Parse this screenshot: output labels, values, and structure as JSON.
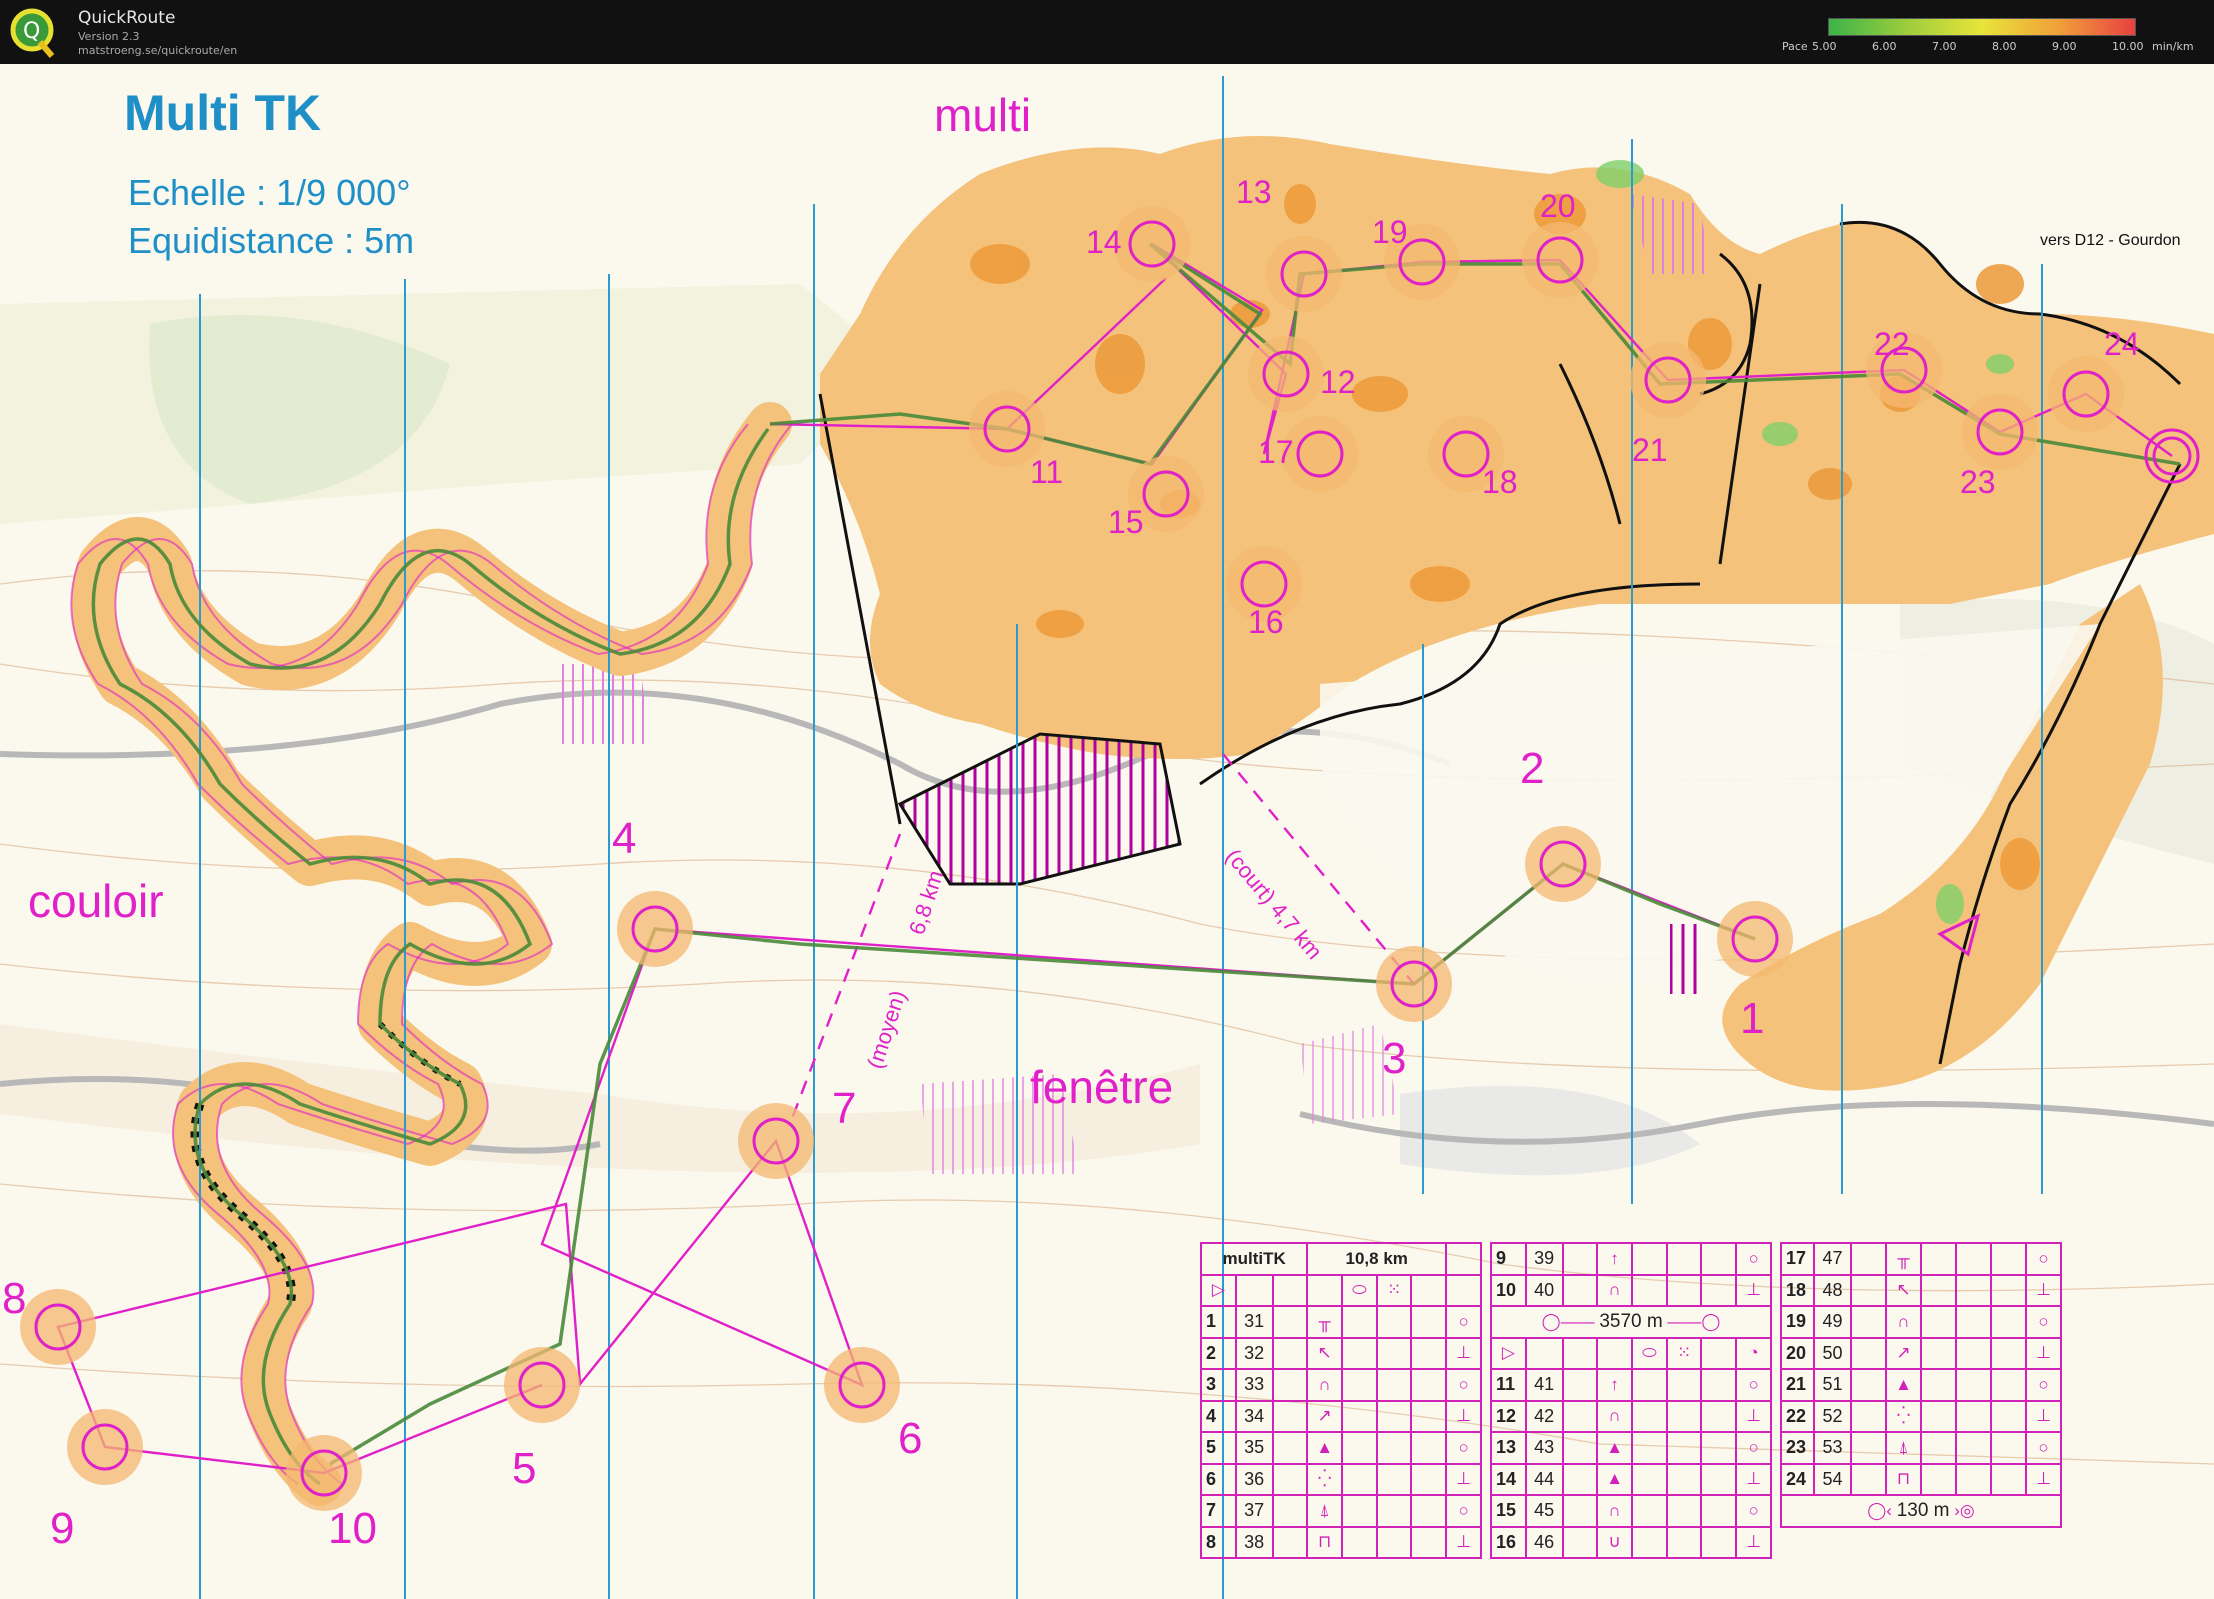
{
  "app": {
    "name": "QuickRoute",
    "version": "Version 2.3",
    "url": "matstroeng.se/quickroute/en"
  },
  "pace_scale": {
    "label": "Pace",
    "ticks": [
      "5.00",
      "6.00",
      "7.00",
      "8.00",
      "9.00",
      "10.00"
    ],
    "unit": "min/km",
    "colors": [
      "#3cb34a",
      "#9ccc3c",
      "#e8e43a",
      "#f0a03a",
      "#e84040"
    ]
  },
  "map": {
    "title": "Multi TK",
    "scale": "Echelle : 1/9 000°",
    "equidistance": "Equidistance : 5m",
    "area_labels": {
      "multi": "multi",
      "couloir": "couloir",
      "fenetre": "fenêtre"
    },
    "road_label": "vers D12 - Gourdon",
    "leg_labels": {
      "short": "(court) 4,7 km",
      "medium": "(moyen)",
      "medium_dist": "6,8 km"
    },
    "controls": [
      "1",
      "2",
      "3",
      "4",
      "5",
      "6",
      "7",
      "8",
      "9",
      "10",
      "11",
      "12",
      "13",
      "14",
      "15",
      "16",
      "17",
      "18",
      "19",
      "20",
      "21",
      "22",
      "23",
      "24"
    ],
    "colors": {
      "course": "#e020c8",
      "route": "#4a8a3a",
      "north_lines": "#2a9bd0",
      "title": "#1f8fc8",
      "forest": "#f4c27a"
    }
  },
  "description": {
    "header": {
      "name": "multiTK",
      "length": "10,8 km"
    },
    "col1": [
      {
        "n": "1",
        "code": "31"
      },
      {
        "n": "2",
        "code": "32"
      },
      {
        "n": "3",
        "code": "33"
      },
      {
        "n": "4",
        "code": "34"
      },
      {
        "n": "5",
        "code": "35"
      },
      {
        "n": "6",
        "code": "36"
      },
      {
        "n": "7",
        "code": "37"
      },
      {
        "n": "8",
        "code": "38"
      }
    ],
    "col2a": [
      {
        "n": "9",
        "code": "39"
      },
      {
        "n": "10",
        "code": "40"
      }
    ],
    "col2_mark": "3570 m",
    "col2b": [
      {
        "n": "11",
        "code": "41"
      },
      {
        "n": "12",
        "code": "42"
      },
      {
        "n": "13",
        "code": "43"
      },
      {
        "n": "14",
        "code": "44"
      },
      {
        "n": "15",
        "code": "45"
      },
      {
        "n": "16",
        "code": "46"
      }
    ],
    "col3": [
      {
        "n": "17",
        "code": "47"
      },
      {
        "n": "18",
        "code": "48"
      },
      {
        "n": "19",
        "code": "49"
      },
      {
        "n": "20",
        "code": "50"
      },
      {
        "n": "21",
        "code": "51"
      },
      {
        "n": "22",
        "code": "52"
      },
      {
        "n": "23",
        "code": "53"
      },
      {
        "n": "24",
        "code": "54"
      }
    ],
    "finish": "130 m"
  }
}
